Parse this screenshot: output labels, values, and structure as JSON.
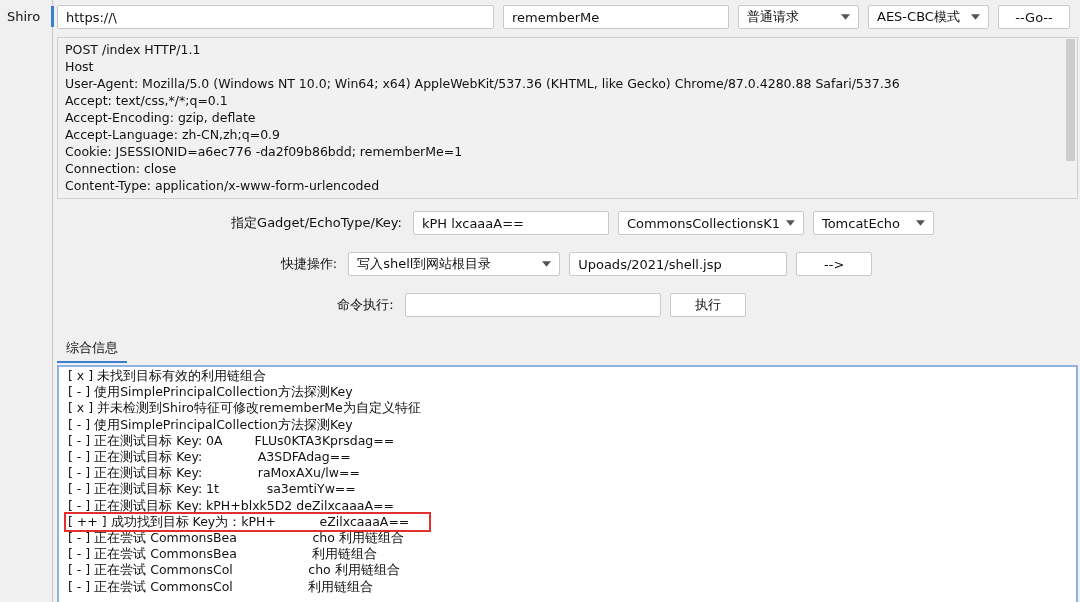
{
  "sidebar": {
    "tabs": [
      {
        "label": "Shiro",
        "selected": true
      }
    ]
  },
  "toolbar": {
    "url": "https://\\",
    "cookie_name": "rememberMe",
    "request_type": "普通请求",
    "mode": "AES-CBC模式",
    "go_button": "--Go--"
  },
  "request_lines": [
    "POST /index HTTP/1.1",
    "Host",
    "User-Agent: Mozilla/5.0 (Windows NT 10.0; Win64; x64) AppleWebKit/537.36 (KHTML, like Gecko) Chrome/87.0.4280.88 Safari/537.36",
    "Accept: text/css,*/*;q=0.1",
    "Accept-Encoding: gzip, deflate",
    "Accept-Language: zh-CN,zh;q=0.9",
    "Cookie: JSESSIONID=a6ec776 -da2f09b86bdd; rememberMe=1",
    "Connection: close",
    "Content-Type: application/x-www-form-urlencoded"
  ],
  "gadget_row": {
    "label": "指定Gadget/EchoType/Key:",
    "key": "kPH lxcaaaA==",
    "gadget": "CommonsCollectionsK1",
    "echo": "TomcatEcho"
  },
  "quick_row": {
    "label": "快捷操作:",
    "action": "写入shell到网站根目录",
    "path": "Upoads/2021/shell.jsp",
    "button": "-->"
  },
  "command_row": {
    "label": "命令执行:",
    "button": "执行"
  },
  "log_tabs": [
    {
      "label": "综合信息",
      "selected": true
    }
  ],
  "log_lines": [
    {
      "text": "[ x ] 未找到目标有效的利用链组合",
      "highlighted": false
    },
    {
      "text": "[ - ] 使用SimplePrincipalCollection方法探测Key",
      "highlighted": false
    },
    {
      "text": "[ x ] 并未检测到Shiro特征可修改rememberMe为自定义特征",
      "highlighted": false
    },
    {
      "text": "[ - ] 使用SimplePrincipalCollection方法探测Key",
      "highlighted": false
    },
    {
      "text": "[ - ] 正在测试目标 Key: 0A        FLUs0KTA3Kprsdag==",
      "highlighted": false
    },
    {
      "text": "[ - ] 正在测试目标 Key:              A3SDFAdag==",
      "highlighted": false
    },
    {
      "text": "[ - ] 正在测试目标 Key:              raMoxAXu/lw==",
      "highlighted": false
    },
    {
      "text": "[ - ] 正在测试目标 Key: 1t            sa3emtiYw==",
      "highlighted": false
    },
    {
      "text": "[ - ] 正在测试目标 Key: kPH+blxk5D2 deZilxcaaaA==",
      "highlighted": false
    },
    {
      "text": "[ ++ ] 成功找到目标 Key为：kPH+           eZilxcaaaA==",
      "highlighted": true
    },
    {
      "text": "[ - ] 正在尝试 CommonsBea                   cho 利用链组合",
      "highlighted": false
    },
    {
      "text": "[ - ] 正在尝试 CommonsBea                   利用链组合",
      "highlighted": false
    },
    {
      "text": "[ - ] 正在尝试 CommonsCol                   cho 利用链组合",
      "highlighted": false
    },
    {
      "text": "[ - ] 正在尝试 CommonsCol                   利用链组合",
      "highlighted": false
    }
  ]
}
